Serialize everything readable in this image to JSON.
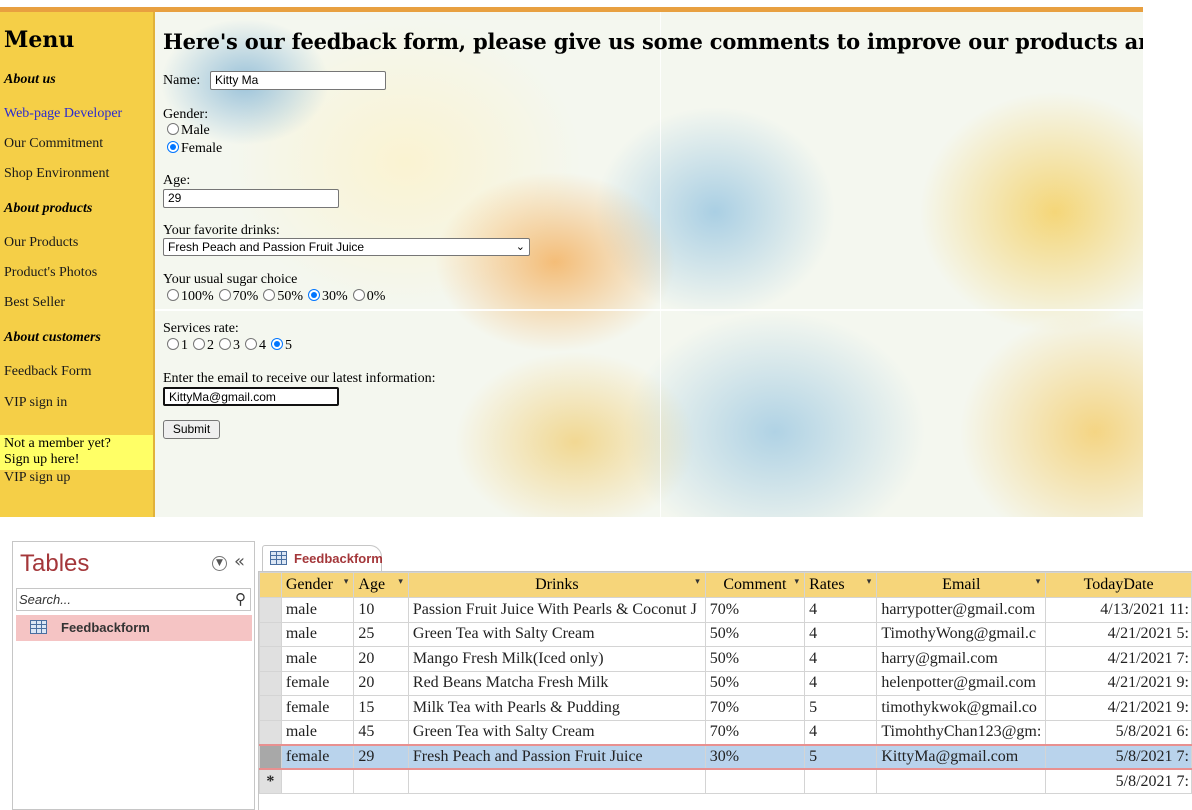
{
  "web": {
    "menu": {
      "title": "Menu",
      "items": [
        {
          "label": "About us",
          "type": "head"
        },
        {
          "label": "Web-page Developer",
          "type": "link"
        },
        {
          "label": "Our Commitment",
          "type": "item"
        },
        {
          "label": "Shop Environment",
          "type": "item"
        },
        {
          "label": "About products",
          "type": "head"
        },
        {
          "label": "Our Products",
          "type": "item"
        },
        {
          "label": "Product's Photos",
          "type": "item"
        },
        {
          "label": "Best Seller",
          "type": "item"
        },
        {
          "label": "About customers",
          "type": "head"
        },
        {
          "label": "Feedback Form",
          "type": "item"
        },
        {
          "label": "VIP sign in",
          "type": "item"
        },
        {
          "label": "VIP sign up",
          "type": "item"
        }
      ],
      "signup_note_line1": "Not a member yet?",
      "signup_note_line2": "Sign up here!"
    },
    "form": {
      "title": "Here's our feedback form, please give us some comments to improve our products and services.",
      "name_label": "Name:",
      "name_value": "Kitty Ma",
      "gender_label": "Gender:",
      "gender_options": [
        "Male",
        "Female"
      ],
      "gender_selected": "Female",
      "age_label": "Age:",
      "age_value": "29",
      "drinks_label": "Your favorite drinks:",
      "drinks_value": "Fresh Peach and Passion Fruit Juice",
      "sugar_label": "Your usual sugar choice",
      "sugar_options": [
        "100%",
        "70%",
        "50%",
        "30%",
        "0%"
      ],
      "sugar_selected": "30%",
      "rate_label": "Services rate:",
      "rate_options": [
        "1",
        "2",
        "3",
        "4",
        "5"
      ],
      "rate_selected": "5",
      "email_label": "Enter the email to receive our latest information:",
      "email_value": "KittyMa@gmail.com",
      "submit_label": "Submit"
    },
    "colors": {
      "menu_bg": "#f5cf47",
      "signup_bg": "#ffff66",
      "link": "#2b2bcf",
      "radio_on": "#0075ff"
    }
  },
  "access": {
    "nav": {
      "title": "Tables",
      "search_placeholder": "Search...",
      "items": [
        "Feedbackform"
      ]
    },
    "tab_label": "Feedbackform",
    "columns": [
      "Gender",
      "Age",
      "Drinks",
      "Comment",
      "Rates",
      "Email",
      "TodayDate"
    ],
    "rows": [
      [
        "male",
        "10",
        "Passion Fruit Juice With Pearls & Coconut J",
        "70%",
        "4",
        "harrypotter@gmail.com",
        "4/13/2021 11:"
      ],
      [
        "male",
        "25",
        "Green Tea with Salty Cream",
        "50%",
        "4",
        "TimothyWong@gmail.c",
        "4/21/2021 5:"
      ],
      [
        "male",
        "20",
        "Mango Fresh Milk(Iced only)",
        "50%",
        "4",
        "harry@gmail.com",
        "4/21/2021 7:"
      ],
      [
        "female",
        "20",
        "Red Beans Matcha Fresh Milk",
        "50%",
        "4",
        "helenpotter@gmail.com",
        "4/21/2021 9:"
      ],
      [
        "female",
        "15",
        "Milk Tea with Pearls & Pudding",
        "70%",
        "5",
        "timothykwok@gmail.co",
        "4/21/2021 9:"
      ],
      [
        "male",
        "45",
        "Green Tea with Salty Cream",
        "70%",
        "4",
        "TimohthyChan123@gm:",
        "5/8/2021 6:"
      ],
      [
        "female",
        "29",
        "Fresh Peach and Passion Fruit Juice",
        "30%",
        "5",
        "KittyMa@gmail.com",
        "5/8/2021 7:"
      ]
    ],
    "active_row": 6,
    "new_row_marker": "*",
    "new_row_date": "5/8/2021 7:",
    "colors": {
      "header_bg": "#f6d57a",
      "selected_row": "#b9d3ec",
      "title": "#a4373a",
      "nav_selected": "#f5c4c4"
    }
  }
}
